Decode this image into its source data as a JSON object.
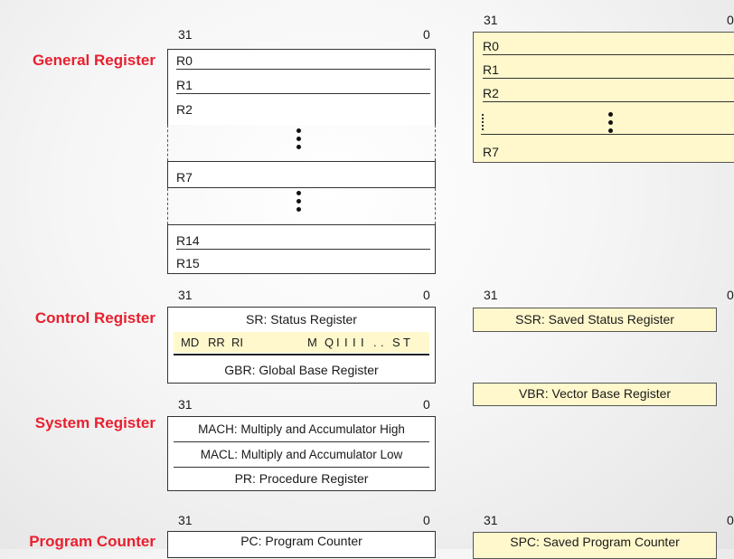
{
  "sections": {
    "general": "General Register",
    "control": "Control Register",
    "system": "System Register",
    "pc": "Program Counter"
  },
  "bits": {
    "high": "31",
    "low": "0"
  },
  "general_bank0": [
    "R0",
    "R1",
    "R2",
    "R7",
    "R14",
    "R15"
  ],
  "general_bank1": [
    "R0",
    "R1",
    "R2",
    "R7"
  ],
  "control": {
    "sr": "SR: Status Register",
    "sr_bits": [
      "MD",
      "RR",
      "RI",
      "M",
      "Q",
      "I",
      "I",
      "I",
      "I",
      ".",
      ".",
      "S",
      "T"
    ],
    "gbr": "GBR: Global Base Register",
    "ssr": "SSR: Saved Status Register",
    "vbr": "VBR: Vector Base Register"
  },
  "system": {
    "mach": "MACH: Multiply and Accumulator High",
    "macl": "MACL: Multiply and Accumulator Low",
    "pr": "PR: Procedure Register"
  },
  "pc": {
    "pc": "PC: Program Counter",
    "spc": "SPC: Saved Program Counter"
  }
}
